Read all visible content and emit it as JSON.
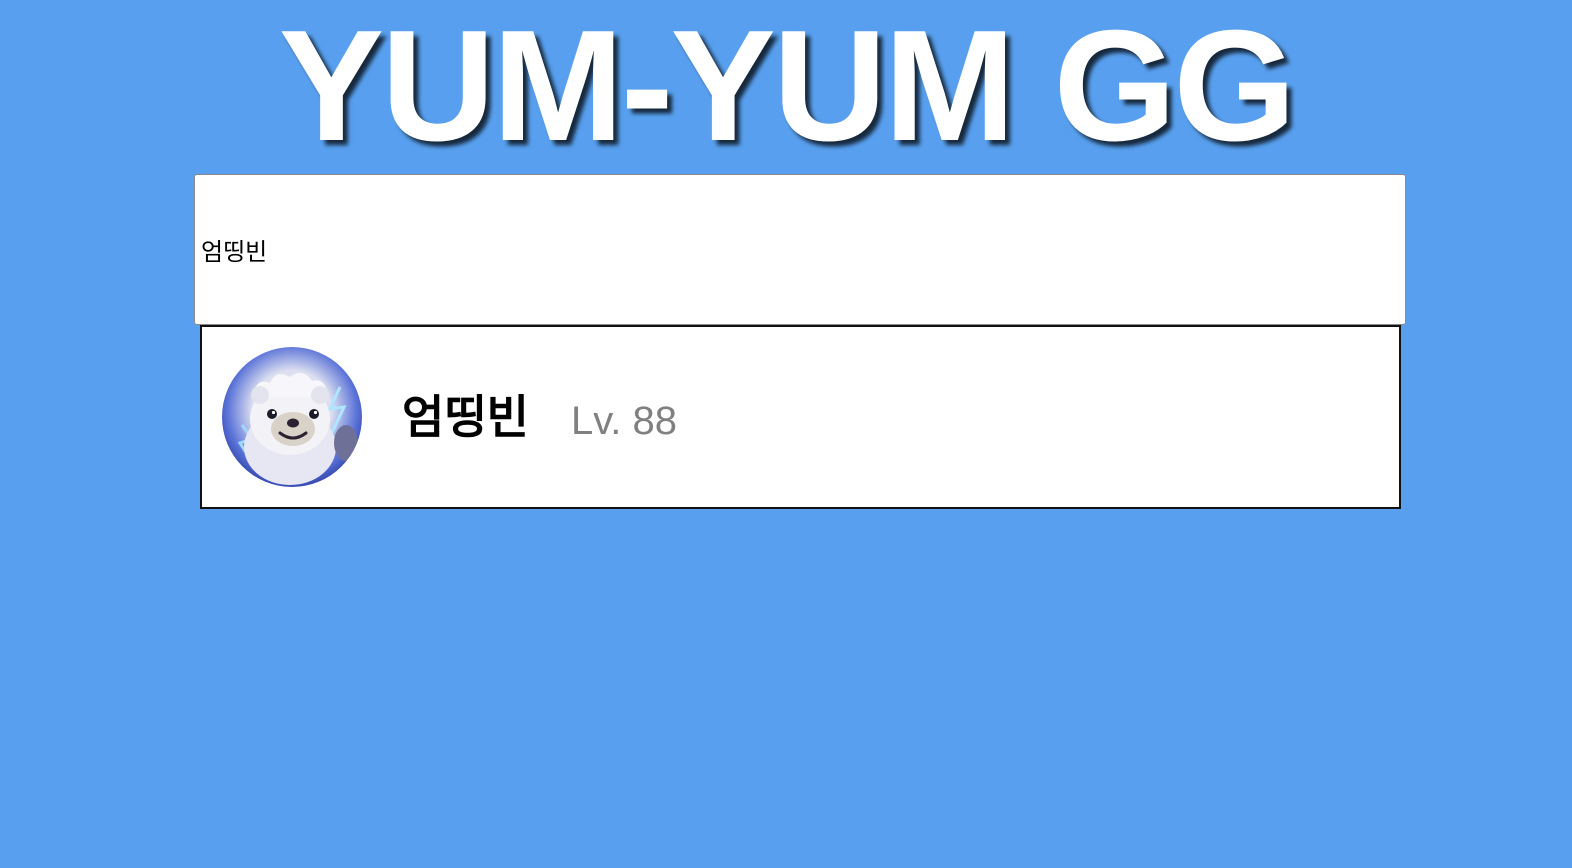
{
  "header": {
    "logo_text": "YUM-YUM GG"
  },
  "search": {
    "value": "엄띵빈",
    "placeholder": ""
  },
  "result": {
    "summoner_name": "엄띵빈",
    "level_text": "Lv. 88",
    "avatar_icon": "snow-bear-profile-icon"
  },
  "colors": {
    "background": "#58a0ef",
    "logo_text": "#ffffff",
    "level_text": "#808080",
    "card_border": "#111111"
  }
}
